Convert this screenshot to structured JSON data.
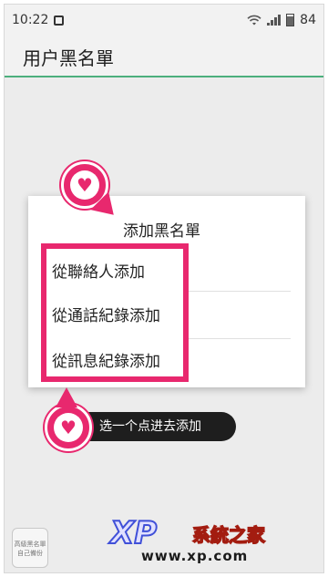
{
  "status_bar": {
    "time": "10:22",
    "battery": "84"
  },
  "app_bar": {
    "title": "用户黑名單"
  },
  "dialog": {
    "title": "添加黑名單",
    "options": [
      {
        "label": "從聯絡人添加"
      },
      {
        "label": "從通話紀錄添加"
      },
      {
        "label": "從訊息紀錄添加"
      }
    ]
  },
  "annotation": {
    "hint": "选一个点进去添加"
  },
  "watermark": {
    "brand_xp": "XP",
    "brand_name": "系統之家",
    "url": "www.xp.com"
  },
  "stamp": {
    "line1": "高級黑名單",
    "line2": "自己備份"
  },
  "colors": {
    "accent_pink": "#e8286e",
    "divider_green": "#4caf7d"
  },
  "icons": [
    "app-notification-icon",
    "wifi-icon",
    "signal-icon",
    "battery-icon",
    "heart-icon"
  ]
}
